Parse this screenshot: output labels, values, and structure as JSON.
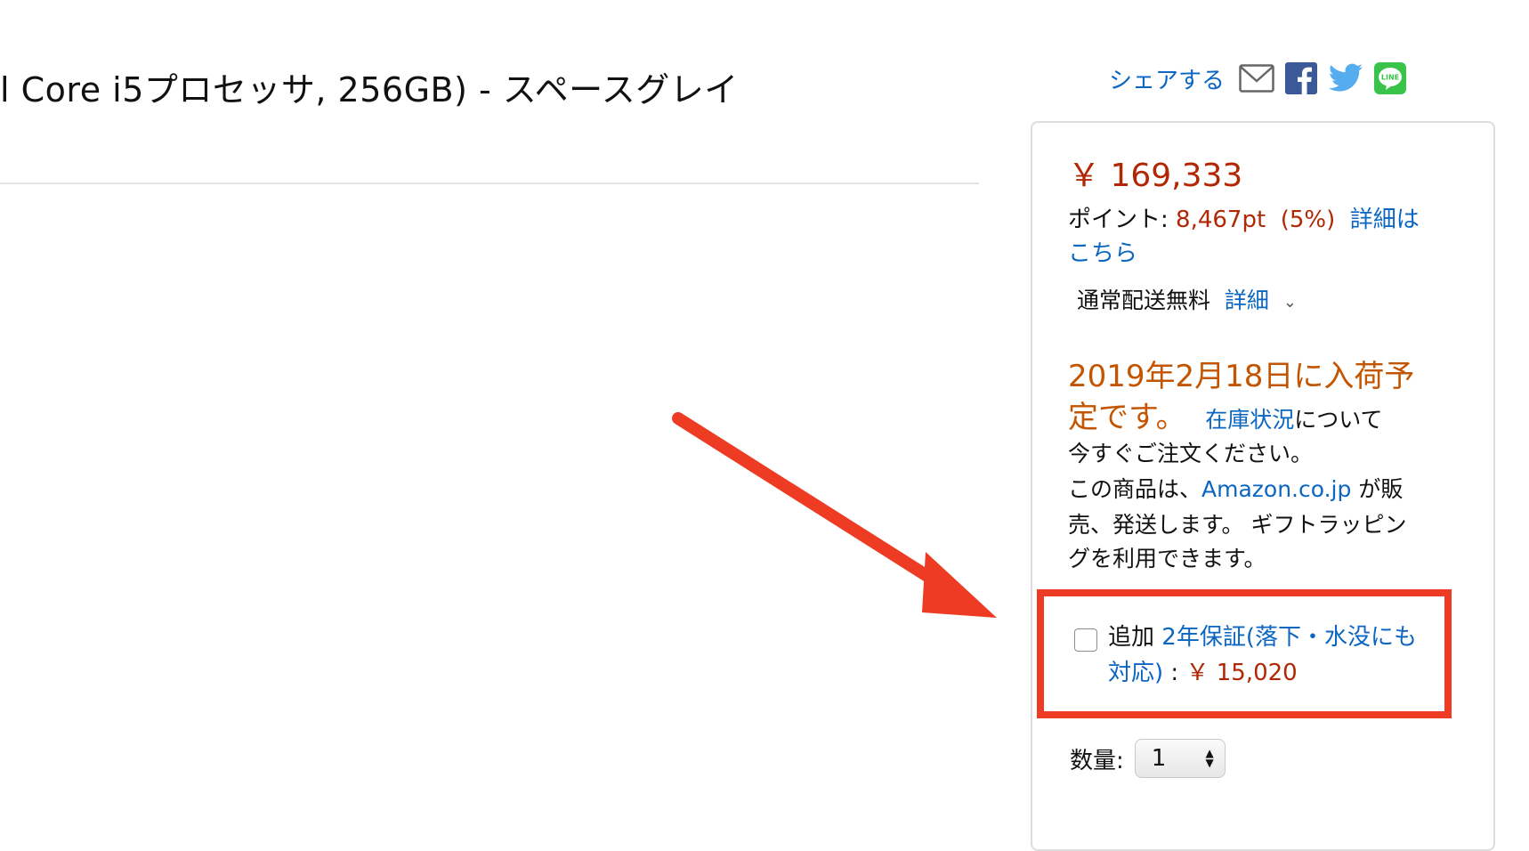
{
  "product": {
    "title": "l Core i5プロセッサ, 256GB) - スペースグレイ"
  },
  "share": {
    "label": "シェアする",
    "icons": [
      "mail-icon",
      "facebook-icon",
      "twitter-icon",
      "line-icon"
    ],
    "line_text": "LINE"
  },
  "buybox": {
    "price": "￥ 169,333",
    "points_label": "ポイント:",
    "points_value": "8,467pt",
    "points_percent": "(5%)",
    "points_link_1": "詳細は",
    "points_link_2": "こちら",
    "shipping_label": "通常配送無料",
    "shipping_link": "詳細",
    "availability_1": "2019年2月18日に入荷予",
    "availability_2": "定です。",
    "stock_link": "在庫状況",
    "stock_suffix": "について",
    "order_now": "今すぐご注文ください。",
    "seller_prefix": "この商品は、",
    "seller_link": "Amazon.co.jp",
    "seller_suffix": " が販",
    "seller_line2": "売、発送します。 ギフトラッピン",
    "seller_line3": "グを利用できます。",
    "warranty_prefix": "追加",
    "warranty_link_1": "2年保証(落下・水没にも",
    "warranty_link_2": "対応)",
    "warranty_sep": " : ",
    "warranty_price": "￥ 15,020",
    "quantity_label": "数量:",
    "quantity_value": "1"
  },
  "colors": {
    "price_red": "#b12704",
    "link_blue": "#0b66c2",
    "availability_orange": "#c45500",
    "annotation_red": "#ee3b24"
  }
}
